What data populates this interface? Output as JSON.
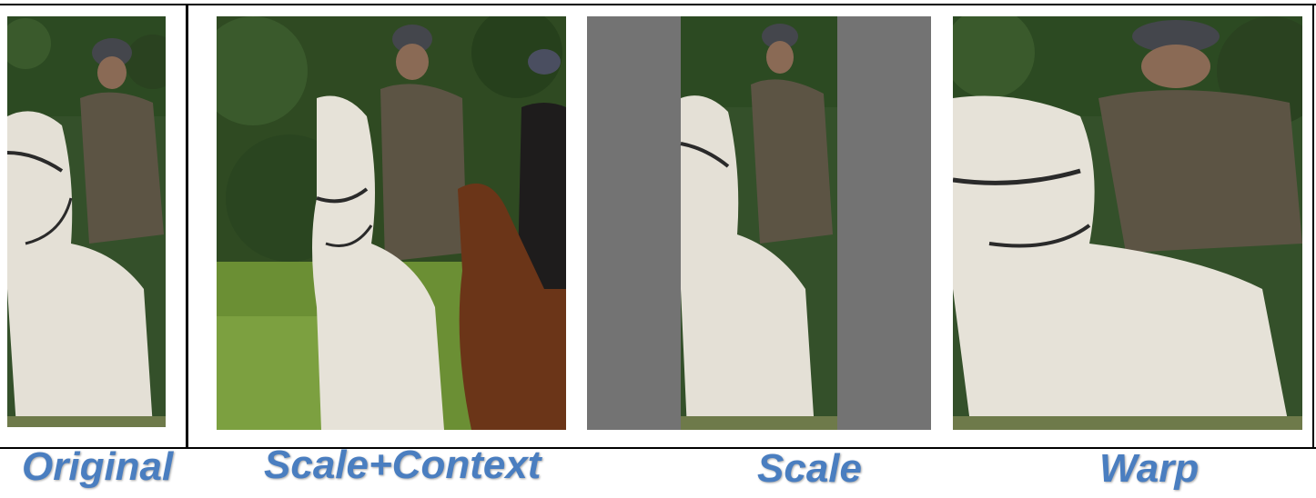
{
  "captions": {
    "original": "Original",
    "scale_context": "Scale+Context",
    "scale": "Scale",
    "warp": "Warp"
  },
  "colors": {
    "caption": "#4a7ec0",
    "padding_gray": "#737373",
    "foliage": "#2f4a22",
    "grass": "#6b8f34",
    "horse_white": "#e6e2d8",
    "horse_brown": "#6b3518",
    "jacket": "#5c5444",
    "helmet": "#44464c"
  }
}
